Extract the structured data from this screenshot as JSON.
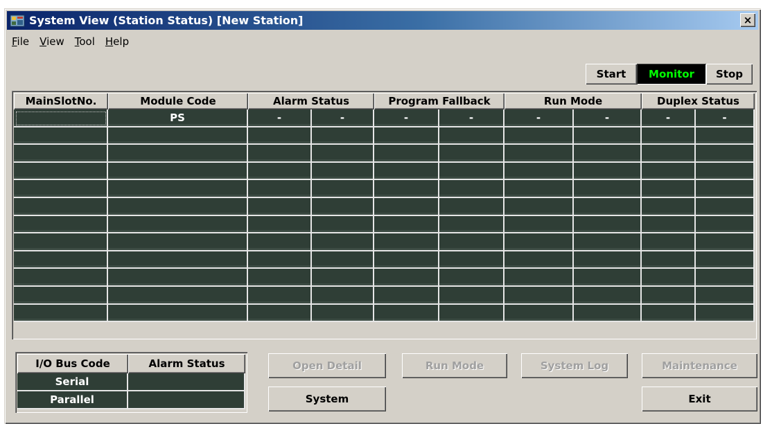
{
  "window": {
    "title": "System View (Station Status) [New Station]",
    "close_label": "×"
  },
  "menu": [
    {
      "label": "File",
      "mnemonic": "F"
    },
    {
      "label": "View",
      "mnemonic": "V"
    },
    {
      "label": "Tool",
      "mnemonic": "T"
    },
    {
      "label": "Help",
      "mnemonic": "H"
    }
  ],
  "mode_buttons": {
    "start": "Start",
    "monitor": "Monitor",
    "stop": "Stop",
    "active": "monitor"
  },
  "colors": {
    "active_mode_text": "#00ff00",
    "grid_cell_bg": "#2f3e36"
  },
  "module_table": {
    "headers": [
      "MainSlotNo.",
      "Module Code",
      "Alarm Status",
      "Program Fallback",
      "Run Mode",
      "Duplex Status"
    ],
    "rows": [
      [
        "",
        "PS",
        "-",
        "-",
        "-",
        "-",
        "-",
        "-",
        "-",
        "-"
      ],
      [
        "",
        "",
        "",
        "",
        "",
        "",
        "",
        "",
        "",
        ""
      ],
      [
        "",
        "",
        "",
        "",
        "",
        "",
        "",
        "",
        "",
        ""
      ],
      [
        "",
        "",
        "",
        "",
        "",
        "",
        "",
        "",
        "",
        ""
      ],
      [
        "",
        "",
        "",
        "",
        "",
        "",
        "",
        "",
        "",
        ""
      ],
      [
        "",
        "",
        "",
        "",
        "",
        "",
        "",
        "",
        "",
        ""
      ],
      [
        "",
        "",
        "",
        "",
        "",
        "",
        "",
        "",
        "",
        ""
      ],
      [
        "",
        "",
        "",
        "",
        "",
        "",
        "",
        "",
        "",
        ""
      ],
      [
        "",
        "",
        "",
        "",
        "",
        "",
        "",
        "",
        "",
        ""
      ],
      [
        "",
        "",
        "",
        "",
        "",
        "",
        "",
        "",
        "",
        ""
      ],
      [
        "",
        "",
        "",
        "",
        "",
        "",
        "",
        "",
        "",
        ""
      ],
      [
        "",
        "",
        "",
        "",
        "",
        "",
        "",
        "",
        "",
        ""
      ]
    ]
  },
  "io_bus_table": {
    "headers": [
      "I/O Bus Code",
      "Alarm Status"
    ],
    "rows": [
      [
        "Serial",
        ""
      ],
      [
        "Parallel",
        ""
      ]
    ]
  },
  "buttons": {
    "open_detail": "Open Detail",
    "run_mode": "Run Mode",
    "system_log": "System Log",
    "maintenance": "Maintenance",
    "system": "System",
    "exit": "Exit"
  }
}
